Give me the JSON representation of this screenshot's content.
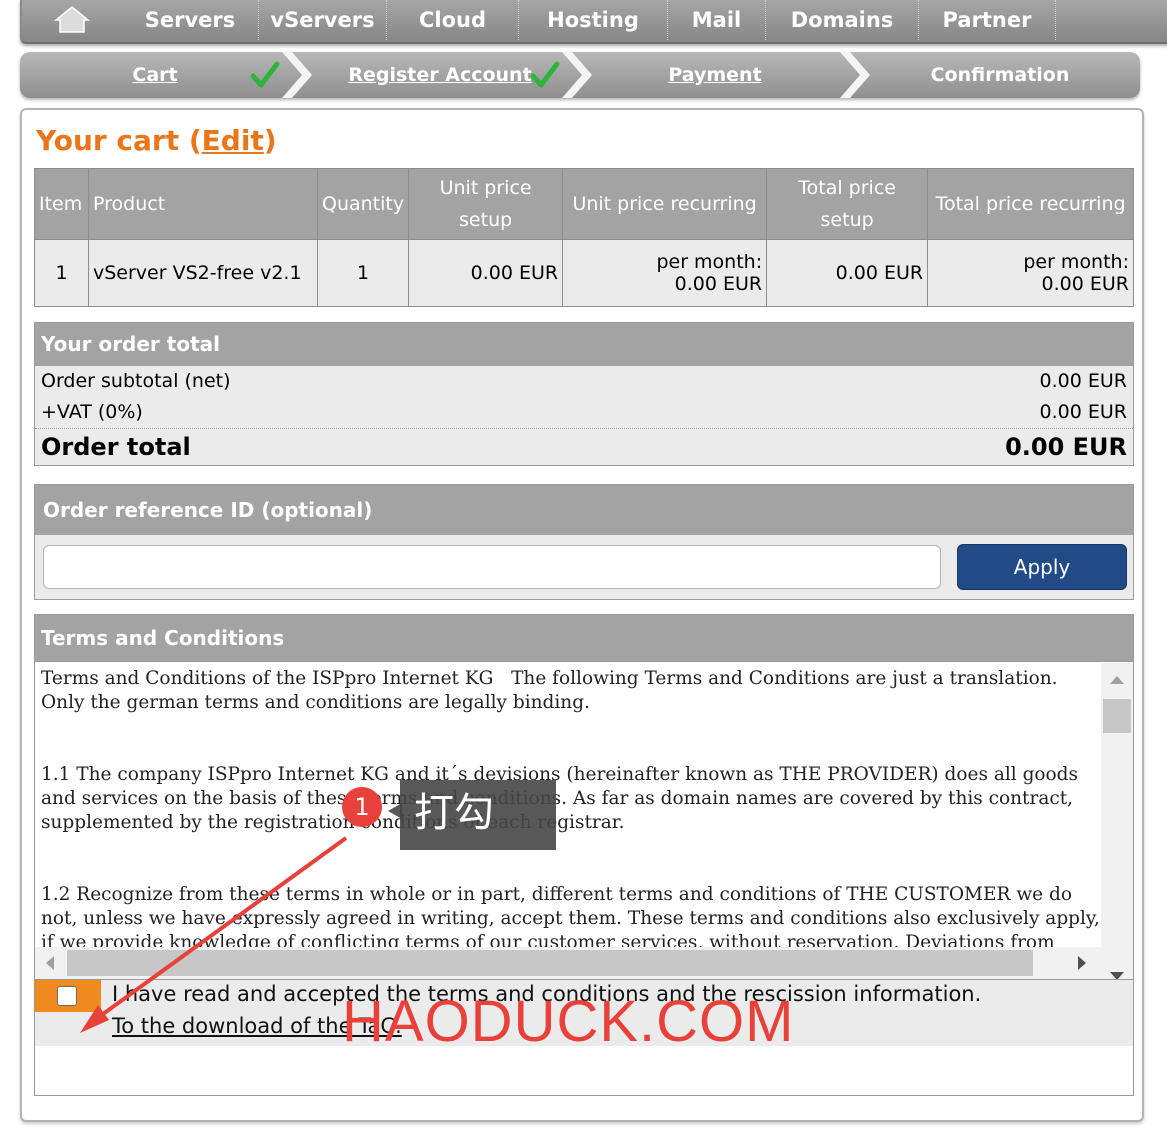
{
  "nav": {
    "items": [
      {
        "label": "Servers"
      },
      {
        "label": "vServers"
      },
      {
        "label": "Cloud"
      },
      {
        "label": "Hosting"
      },
      {
        "label": "Mail"
      },
      {
        "label": "Domains"
      },
      {
        "label": "Partner"
      }
    ]
  },
  "steps": [
    {
      "label": "Cart",
      "done": true
    },
    {
      "label": "Register Account",
      "done": true
    },
    {
      "label": "Payment",
      "done": false
    },
    {
      "label": "Confirmation",
      "done": false
    }
  ],
  "cart": {
    "title": "Your cart",
    "edit_label": "Edit",
    "columns": [
      "Item",
      "Product",
      "Quantity",
      "Unit price setup",
      "Unit price recurring",
      "Total price setup",
      "Total price recurring"
    ],
    "rows": [
      {
        "item": "1",
        "product": "vServer VS2-free v2.1",
        "quantity": "1",
        "unit_setup": "0.00 EUR",
        "unit_recurring_label": "per month:",
        "unit_recurring": "0.00 EUR",
        "total_setup": "0.00 EUR",
        "total_recurring_label": "per month:",
        "total_recurring": "0.00 EUR"
      }
    ]
  },
  "order_total": {
    "heading": "Your order total",
    "subtotal_label": "Order subtotal (net)",
    "subtotal_value": "0.00 EUR",
    "vat_label": "+VAT (0%)",
    "vat_value": "0.00 EUR",
    "total_label": "Order total",
    "total_value": "0.00 EUR"
  },
  "reference": {
    "heading": "Order reference ID (optional)",
    "input_value": "",
    "apply_label": "Apply"
  },
  "terms": {
    "heading": "Terms and Conditions",
    "text": "Terms and Conditions of the ISPpro Internet KG   The following Terms and Conditions are just a translation. Only the german terms and conditions are legally binding.\n\n\n1.1 The company ISPpro Internet KG and it´s devisions (hereinafter known as THE PROVIDER) does all goods and services on the basis of these terms and conditions. As far as domain names are covered by this contract, supplemented by the registration conditions of each registrar.\n\n\n1.2 Recognize from these terms in whole or in part, different terms and conditions of THE CUSTOMER we do not, unless we have expressly agreed in writing, accept them. These terms and conditions also exclusively apply, if we provide knowledge of conflicting terms of our customer services, without reservation. Deviations from these terms and conditions shall be effective only if THE PROVIDER notice THE CUSTOMER in writing.",
    "agree_text": "I have read and accepted the terms and conditions and the rescission information.",
    "download_link": "To the download of the TaC.",
    "accepted": false
  },
  "annotation": {
    "badge": "1",
    "tip": "打勾",
    "watermark": "HAODUCK.COM"
  },
  "colors": {
    "accent_orange": "#e9761a",
    "apply_blue": "#214a87",
    "header_gray": "#a3a3a3",
    "check_green": "#2fb43a",
    "annotation_red": "#e8413a"
  }
}
